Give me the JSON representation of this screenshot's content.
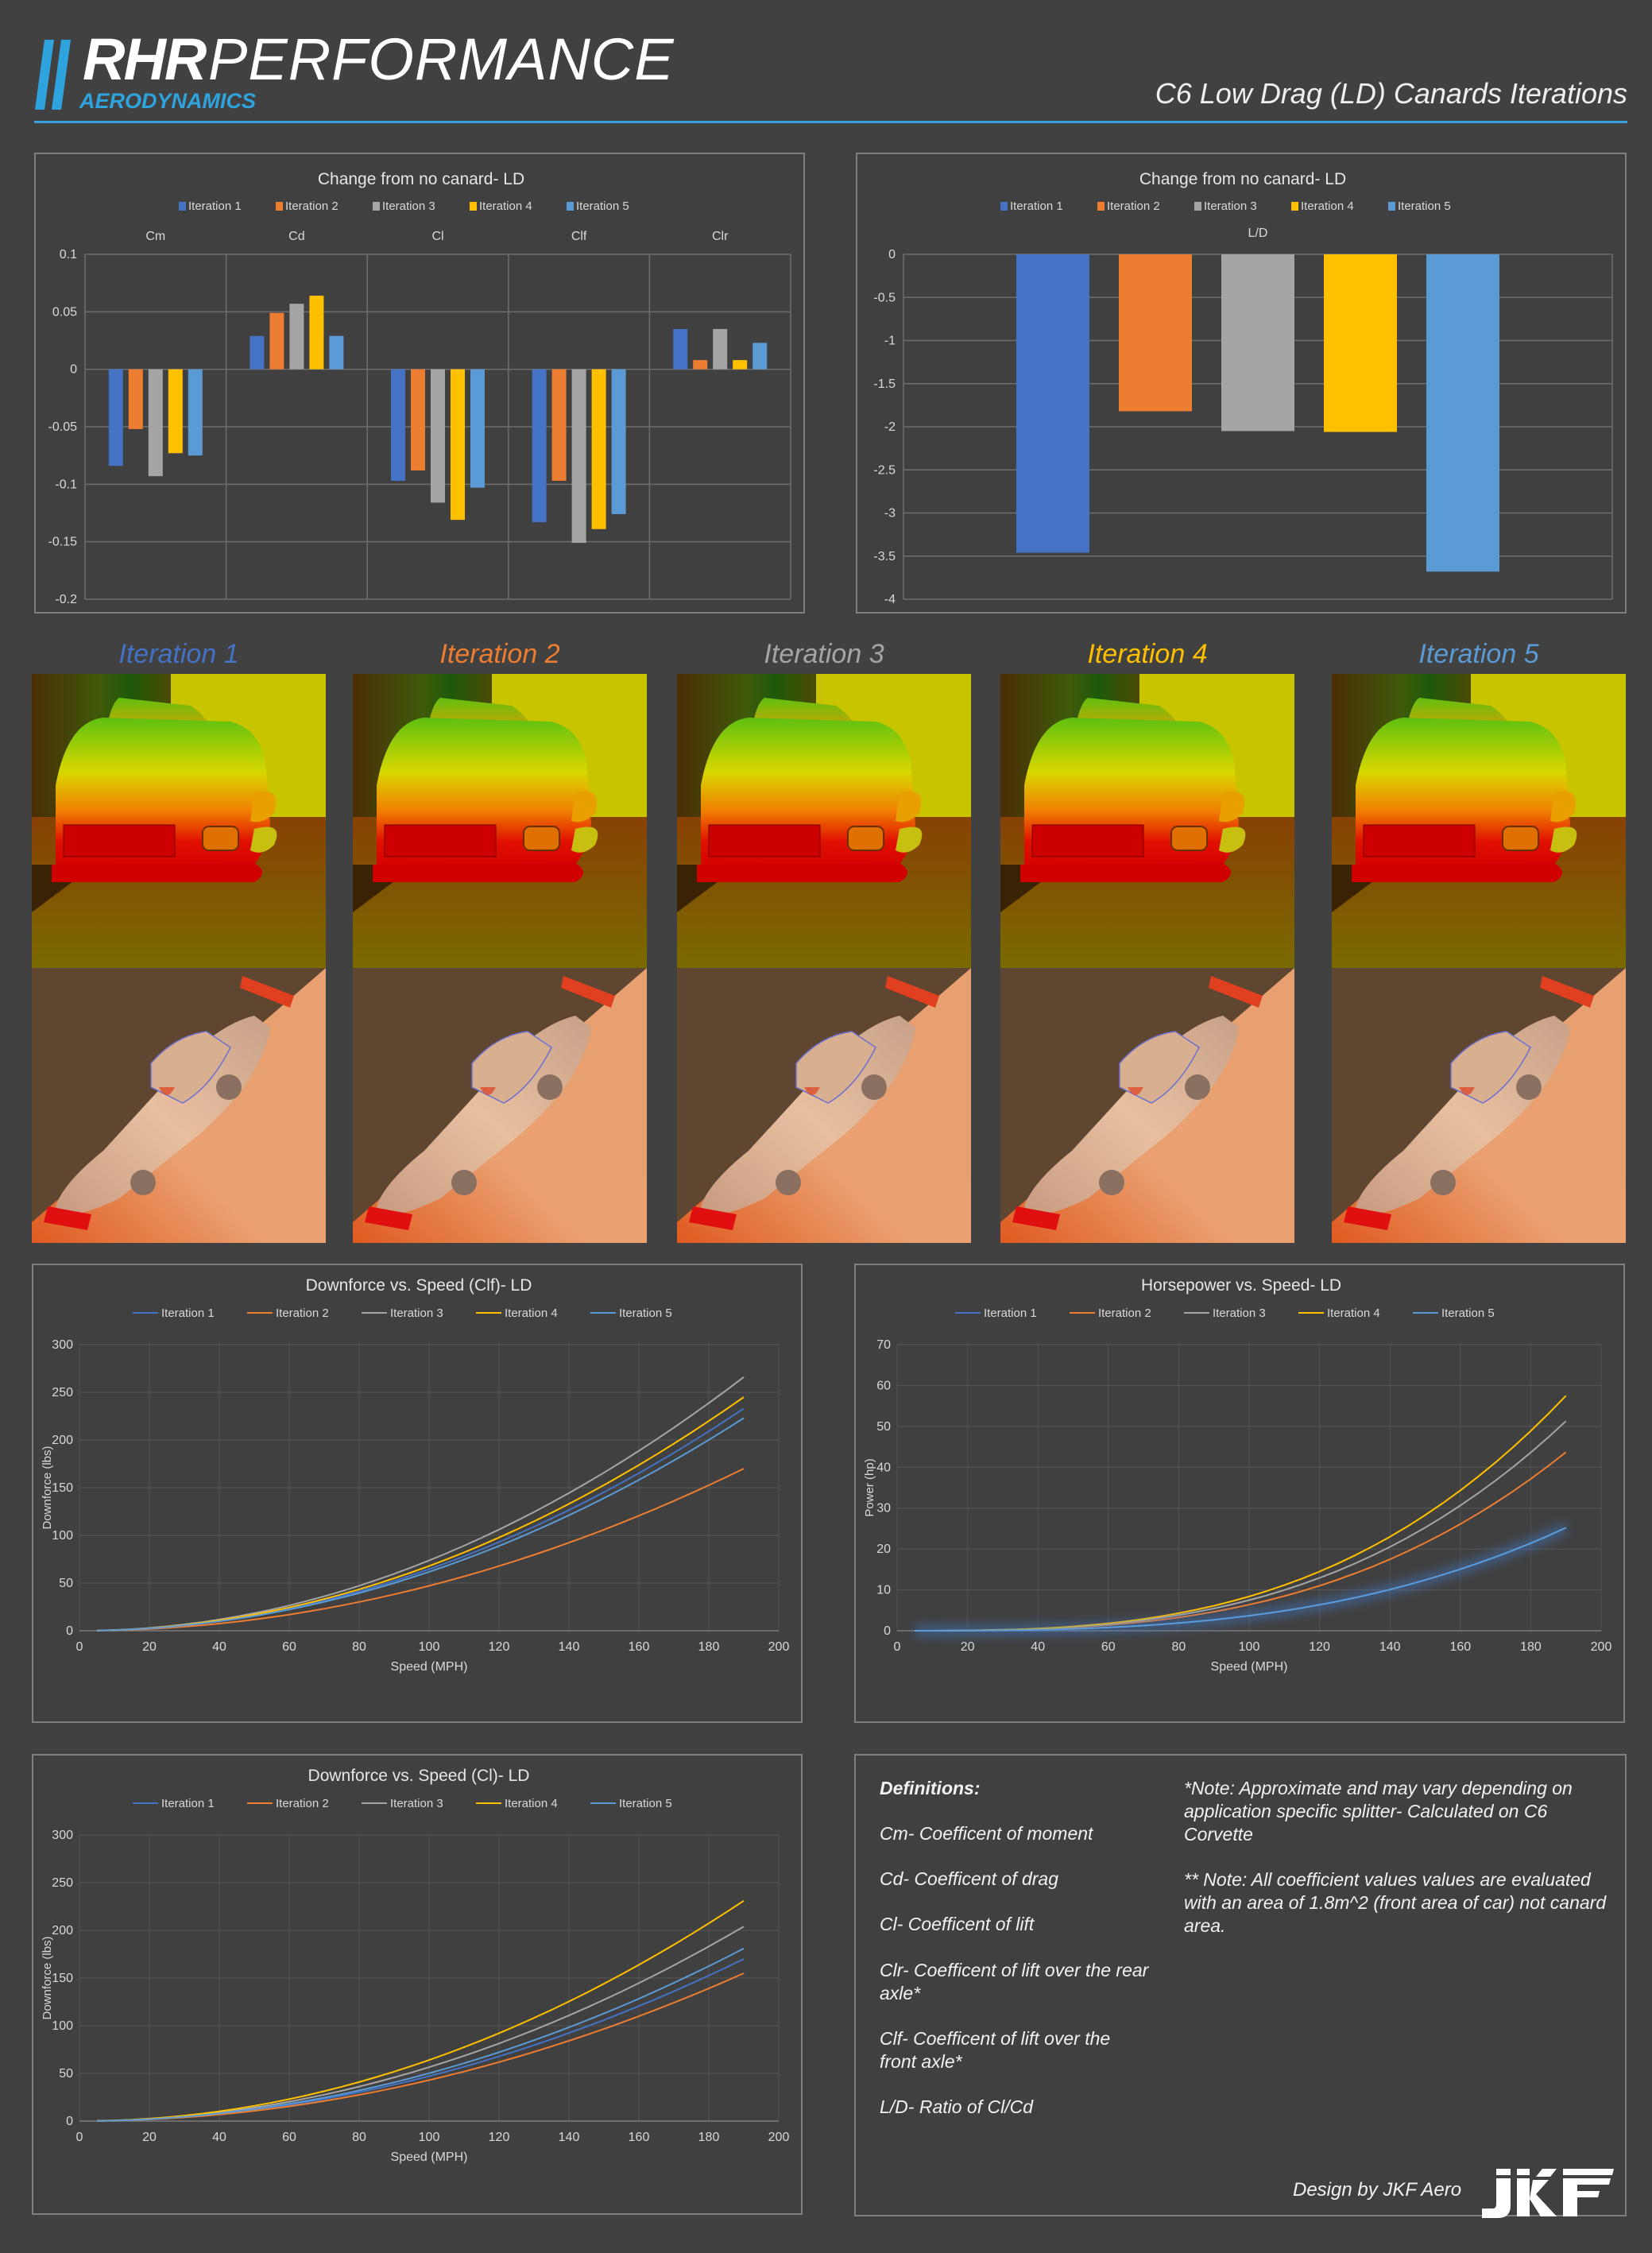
{
  "header": {
    "logo_primary": "RHR",
    "logo_secondary": "PERFORMANCE",
    "logo_sub": "AERODYNAMICS",
    "title": "C6 Low Drag (LD) Canards Iterations"
  },
  "colors": {
    "iteration_1": "#4472c4",
    "iteration_2": "#ed7d31",
    "iteration_3": "#a5a5a5",
    "iteration_4": "#ffc000",
    "iteration_5": "#5b9bd5",
    "brand_blue": "#2fa3dd",
    "background": "#414141"
  },
  "iterations": [
    {
      "label": "Iteration 1",
      "color": "#4472c4"
    },
    {
      "label": "Iteration 2",
      "color": "#ed7d31"
    },
    {
      "label": "Iteration 3",
      "color": "#a5a5a5"
    },
    {
      "label": "Iteration 4",
      "color": "#ffc000"
    },
    {
      "label": "Iteration 5",
      "color": "#5b9bd5"
    }
  ],
  "images": [
    {
      "caption": "Iteration 1",
      "front_view": "cfd-pressure-front-view",
      "top_view": "cfd-pressure-top-view"
    },
    {
      "caption": "Iteration 2",
      "front_view": "cfd-pressure-front-view",
      "top_view": "cfd-pressure-top-view"
    },
    {
      "caption": "Iteration 3",
      "front_view": "cfd-pressure-front-view",
      "top_view": "cfd-pressure-top-view"
    },
    {
      "caption": "Iteration 4",
      "front_view": "cfd-pressure-front-view",
      "top_view": "cfd-pressure-top-view"
    },
    {
      "caption": "Iteration 5",
      "front_view": "cfd-pressure-front-view",
      "top_view": "cfd-pressure-top-view"
    }
  ],
  "chart_data": [
    {
      "id": "coeff",
      "type": "bar",
      "title": "Change from no canard- LD",
      "categories": [
        "Cm",
        "Cd",
        "Cl",
        "Clf",
        "Clr"
      ],
      "series": [
        {
          "name": "Iteration 1",
          "values": [
            -0.084,
            0.029,
            -0.097,
            -0.133,
            0.035
          ]
        },
        {
          "name": "Iteration 2",
          "values": [
            -0.052,
            0.049,
            -0.088,
            -0.097,
            0.008
          ]
        },
        {
          "name": "Iteration 3",
          "values": [
            -0.093,
            0.057,
            -0.116,
            -0.151,
            0.035
          ]
        },
        {
          "name": "Iteration 4",
          "values": [
            -0.073,
            0.064,
            -0.131,
            -0.139,
            0.008
          ]
        },
        {
          "name": "Iteration 5",
          "values": [
            -0.075,
            0.029,
            -0.103,
            -0.126,
            0.023
          ]
        }
      ],
      "ylim": [
        -0.2,
        0.1
      ],
      "yticks": [
        "0.1",
        "0.05",
        "0",
        "-0.05",
        "-0.1",
        "-0.15",
        "-0.2"
      ],
      "legend": "top",
      "category_labels_position": "top",
      "grid": true
    },
    {
      "id": "ld",
      "type": "bar",
      "title": "Change from no canard- LD",
      "categories": [
        "L/D"
      ],
      "series": [
        {
          "name": "Iteration 1",
          "values": [
            -3.46
          ]
        },
        {
          "name": "Iteration 2",
          "values": [
            -1.82
          ]
        },
        {
          "name": "Iteration 3",
          "values": [
            -2.05
          ]
        },
        {
          "name": "Iteration 4",
          "values": [
            -2.06
          ]
        },
        {
          "name": "Iteration 5",
          "values": [
            -3.68
          ]
        }
      ],
      "ylim": [
        -4,
        0
      ],
      "yticks": [
        "0",
        "-0.5",
        "-1",
        "-1.5",
        "-2",
        "-2.5",
        "-3",
        "-3.5",
        "-4"
      ],
      "legend": "top",
      "category_labels_position": "top",
      "grid": true
    },
    {
      "id": "clf",
      "type": "line",
      "title": "Downforce vs. Speed (Clf)- LD",
      "xlabel": "Speed (MPH)",
      "ylabel": "Downforce (lbs)",
      "xlim": [
        0,
        200
      ],
      "ylim": [
        0,
        300
      ],
      "xticks": [
        "0",
        "20",
        "40",
        "60",
        "80",
        "100",
        "120",
        "140",
        "160",
        "180",
        "200"
      ],
      "yticks": [
        "0",
        "50",
        "100",
        "150",
        "200",
        "250",
        "300"
      ],
      "x": [
        5,
        10,
        15,
        20,
        25,
        30,
        35,
        40,
        45,
        50,
        55,
        60,
        65,
        70,
        75,
        80,
        85,
        90,
        95,
        100,
        105,
        110,
        115,
        120,
        125,
        130,
        135,
        140,
        145,
        150,
        155,
        160,
        165,
        170,
        175,
        180,
        185,
        190
      ],
      "model": "value = v_end * (x/190)^2",
      "series": [
        {
          "name": "Iteration 1",
          "value_at_190": 233
        },
        {
          "name": "Iteration 2",
          "value_at_190": 170
        },
        {
          "name": "Iteration 3",
          "value_at_190": 266
        },
        {
          "name": "Iteration 4",
          "value_at_190": 245
        },
        {
          "name": "Iteration 5",
          "value_at_190": 223
        }
      ],
      "legend": "top",
      "grid": true
    },
    {
      "id": "hp",
      "type": "line",
      "title": "Horsepower vs. Speed- LD",
      "xlabel": "Speed (MPH)",
      "ylabel": "Power (hp)",
      "xlim": [
        0,
        200
      ],
      "ylim": [
        0,
        70
      ],
      "xticks": [
        "0",
        "20",
        "40",
        "60",
        "80",
        "100",
        "120",
        "140",
        "160",
        "180",
        "200"
      ],
      "yticks": [
        "0",
        "10",
        "20",
        "30",
        "40",
        "50",
        "60",
        "70"
      ],
      "x": [
        5,
        10,
        15,
        20,
        25,
        30,
        35,
        40,
        45,
        50,
        55,
        60,
        65,
        70,
        75,
        80,
        85,
        90,
        95,
        100,
        105,
        110,
        115,
        120,
        125,
        130,
        135,
        140,
        145,
        150,
        155,
        160,
        165,
        170,
        175,
        180,
        185,
        190
      ],
      "model": "value = v_end * (x/190)^3",
      "series": [
        {
          "name": "Iteration 1",
          "value_at_190": 25.2
        },
        {
          "name": "Iteration 2",
          "value_at_190": 43.7
        },
        {
          "name": "Iteration 3",
          "value_at_190": 51.3
        },
        {
          "name": "Iteration 4",
          "value_at_190": 57.5
        },
        {
          "name": "Iteration 5",
          "value_at_190": 25.2,
          "highlighted": true
        }
      ],
      "legend": "top",
      "grid": true
    },
    {
      "id": "cl",
      "type": "line",
      "title": "Downforce vs. Speed (Cl)- LD",
      "xlabel": "Speed (MPH)",
      "ylabel": "Downforce (lbs)",
      "xlim": [
        0,
        200
      ],
      "ylim": [
        0,
        300
      ],
      "xticks": [
        "0",
        "20",
        "40",
        "60",
        "80",
        "100",
        "120",
        "140",
        "160",
        "180",
        "200"
      ],
      "yticks": [
        "0",
        "50",
        "100",
        "150",
        "200",
        "250",
        "300"
      ],
      "x": [
        5,
        10,
        15,
        20,
        25,
        30,
        35,
        40,
        45,
        50,
        55,
        60,
        65,
        70,
        75,
        80,
        85,
        90,
        95,
        100,
        105,
        110,
        115,
        120,
        125,
        130,
        135,
        140,
        145,
        150,
        155,
        160,
        165,
        170,
        175,
        180,
        185,
        190
      ],
      "model": "value = v_end * (x/190)^2",
      "series": [
        {
          "name": "Iteration 1",
          "value_at_190": 170
        },
        {
          "name": "Iteration 2",
          "value_at_190": 155
        },
        {
          "name": "Iteration 3",
          "value_at_190": 204
        },
        {
          "name": "Iteration 4",
          "value_at_190": 231
        },
        {
          "name": "Iteration 5",
          "value_at_190": 181
        }
      ],
      "legend": "top",
      "grid": true
    }
  ],
  "definitions": {
    "heading": "Definitions:",
    "items": [
      "Cm- Coefficent of moment",
      "Cd- Coefficent of drag",
      "Cl- Coefficent of lift",
      "Clr- Coefficent of lift over the rear axle*",
      "Clf- Coefficent of lift over the front axle*",
      "L/D- Ratio of Cl/Cd"
    ],
    "note_1": "*Note: Approximate and may vary depending on application specific splitter- Calculated on C6 Corvette",
    "note_2": "** Note: All coefficient values values are evaluated with an area of 1.8m^2 (front area of car) not canard area.",
    "credit": "Design by JKF Aero",
    "credit_logo": "JKF"
  }
}
